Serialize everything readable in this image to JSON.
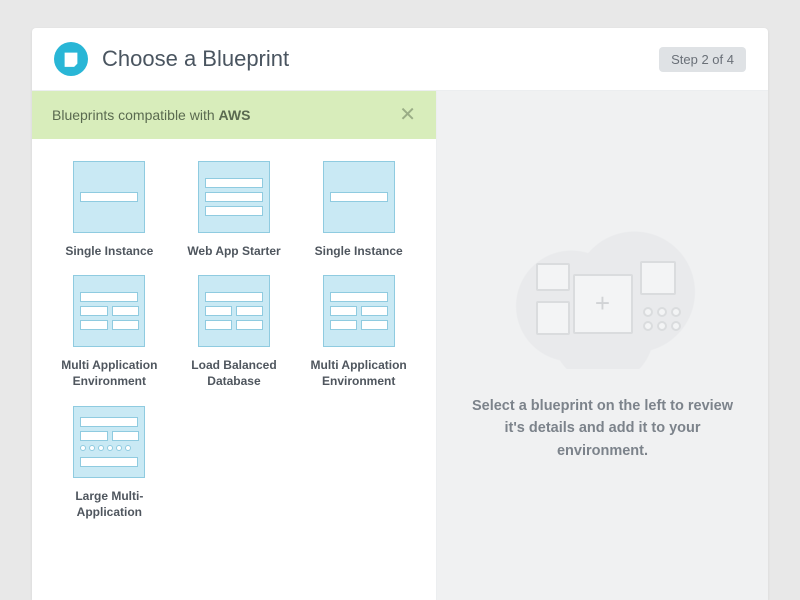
{
  "header": {
    "title": "Choose a Blueprint",
    "step_label": "Step 2 of 4"
  },
  "filter": {
    "prefix": "Blueprints compatible with ",
    "provider": "AWS"
  },
  "blueprints": [
    {
      "label": "Single Instance",
      "thumb": "single"
    },
    {
      "label": "Web App Starter",
      "thumb": "three"
    },
    {
      "label": "Single Instance",
      "thumb": "single"
    },
    {
      "label": "Multi Application Environment",
      "thumb": "multi"
    },
    {
      "label": "Load Balanced Database",
      "thumb": "multi"
    },
    {
      "label": "Multi Application Environment",
      "thumb": "multi"
    },
    {
      "label": "Large Multi-Application",
      "thumb": "large"
    }
  ],
  "detail": {
    "placeholder": "Select a blueprint on the left to review it's details and add it to your environment."
  }
}
